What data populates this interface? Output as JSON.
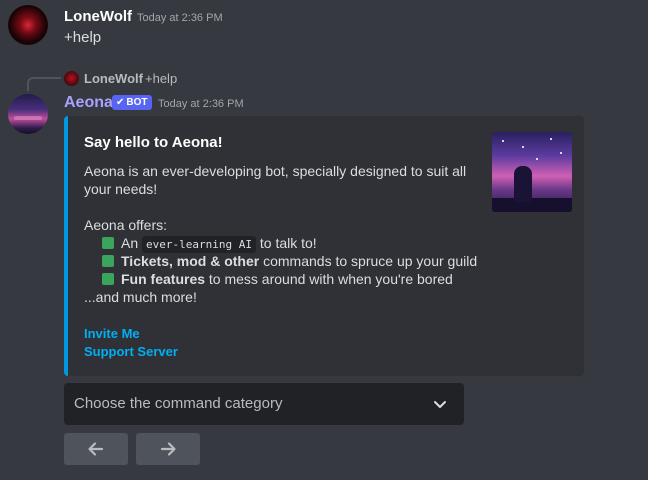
{
  "message1": {
    "username": "LoneWolf",
    "timestamp": "Today at 2:36 PM",
    "text": "+help"
  },
  "reply": {
    "username": "LoneWolf",
    "text": "+help"
  },
  "bot_message": {
    "username": "Aeona",
    "bot_tag": "BOT",
    "timestamp": "Today at 2:36 PM"
  },
  "embed": {
    "accent_color": "#0099e1",
    "title": "Say hello to Aeona!",
    "description": "Aeona is an ever-developing bot, specially designed to suit all your needs!",
    "offers_heading": "Aeona offers:",
    "offers": [
      {
        "prefix": "An ",
        "code": "ever-learning AI",
        "suffix": " to talk to!"
      },
      {
        "bold": "Tickets, mod & other",
        "suffix": " commands to spruce up your guild"
      },
      {
        "bold": "Fun features",
        "suffix": " to mess around with when you're bored"
      }
    ],
    "closing": "...and much more!",
    "links": {
      "invite": "Invite Me",
      "support": "Support Server"
    }
  },
  "select_menu": {
    "placeholder": "Choose the command category"
  },
  "buttons": {
    "prev_icon": "arrow-left-icon",
    "next_icon": "arrow-right-icon"
  },
  "colors": {
    "background": "#36393f",
    "embed_bg": "#2f3136",
    "bot_tag": "#5865f2",
    "link": "#00aff4",
    "bot_name": "#a8a3ff",
    "button": "#4f545c",
    "select_bg": "#202225"
  }
}
